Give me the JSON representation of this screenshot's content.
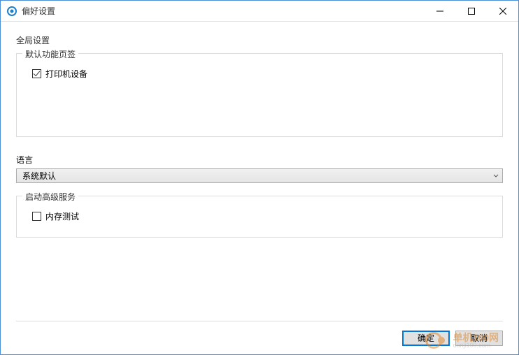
{
  "window": {
    "title": "偏好设置"
  },
  "global": {
    "section_title": "全局设置",
    "default_tab": {
      "legend": "默认功能页签",
      "printer_device_label": "打印机设备",
      "printer_device_checked": true
    },
    "language": {
      "label": "语言",
      "selected": "系统默认"
    },
    "advanced": {
      "legend": "启动高级服务",
      "memory_test_label": "内存测试",
      "memory_test_checked": false
    }
  },
  "footer": {
    "ok_label": "确定",
    "cancel_label": "取消"
  },
  "watermark": {
    "text1": "单机100网",
    "text2": "danji100.com"
  }
}
